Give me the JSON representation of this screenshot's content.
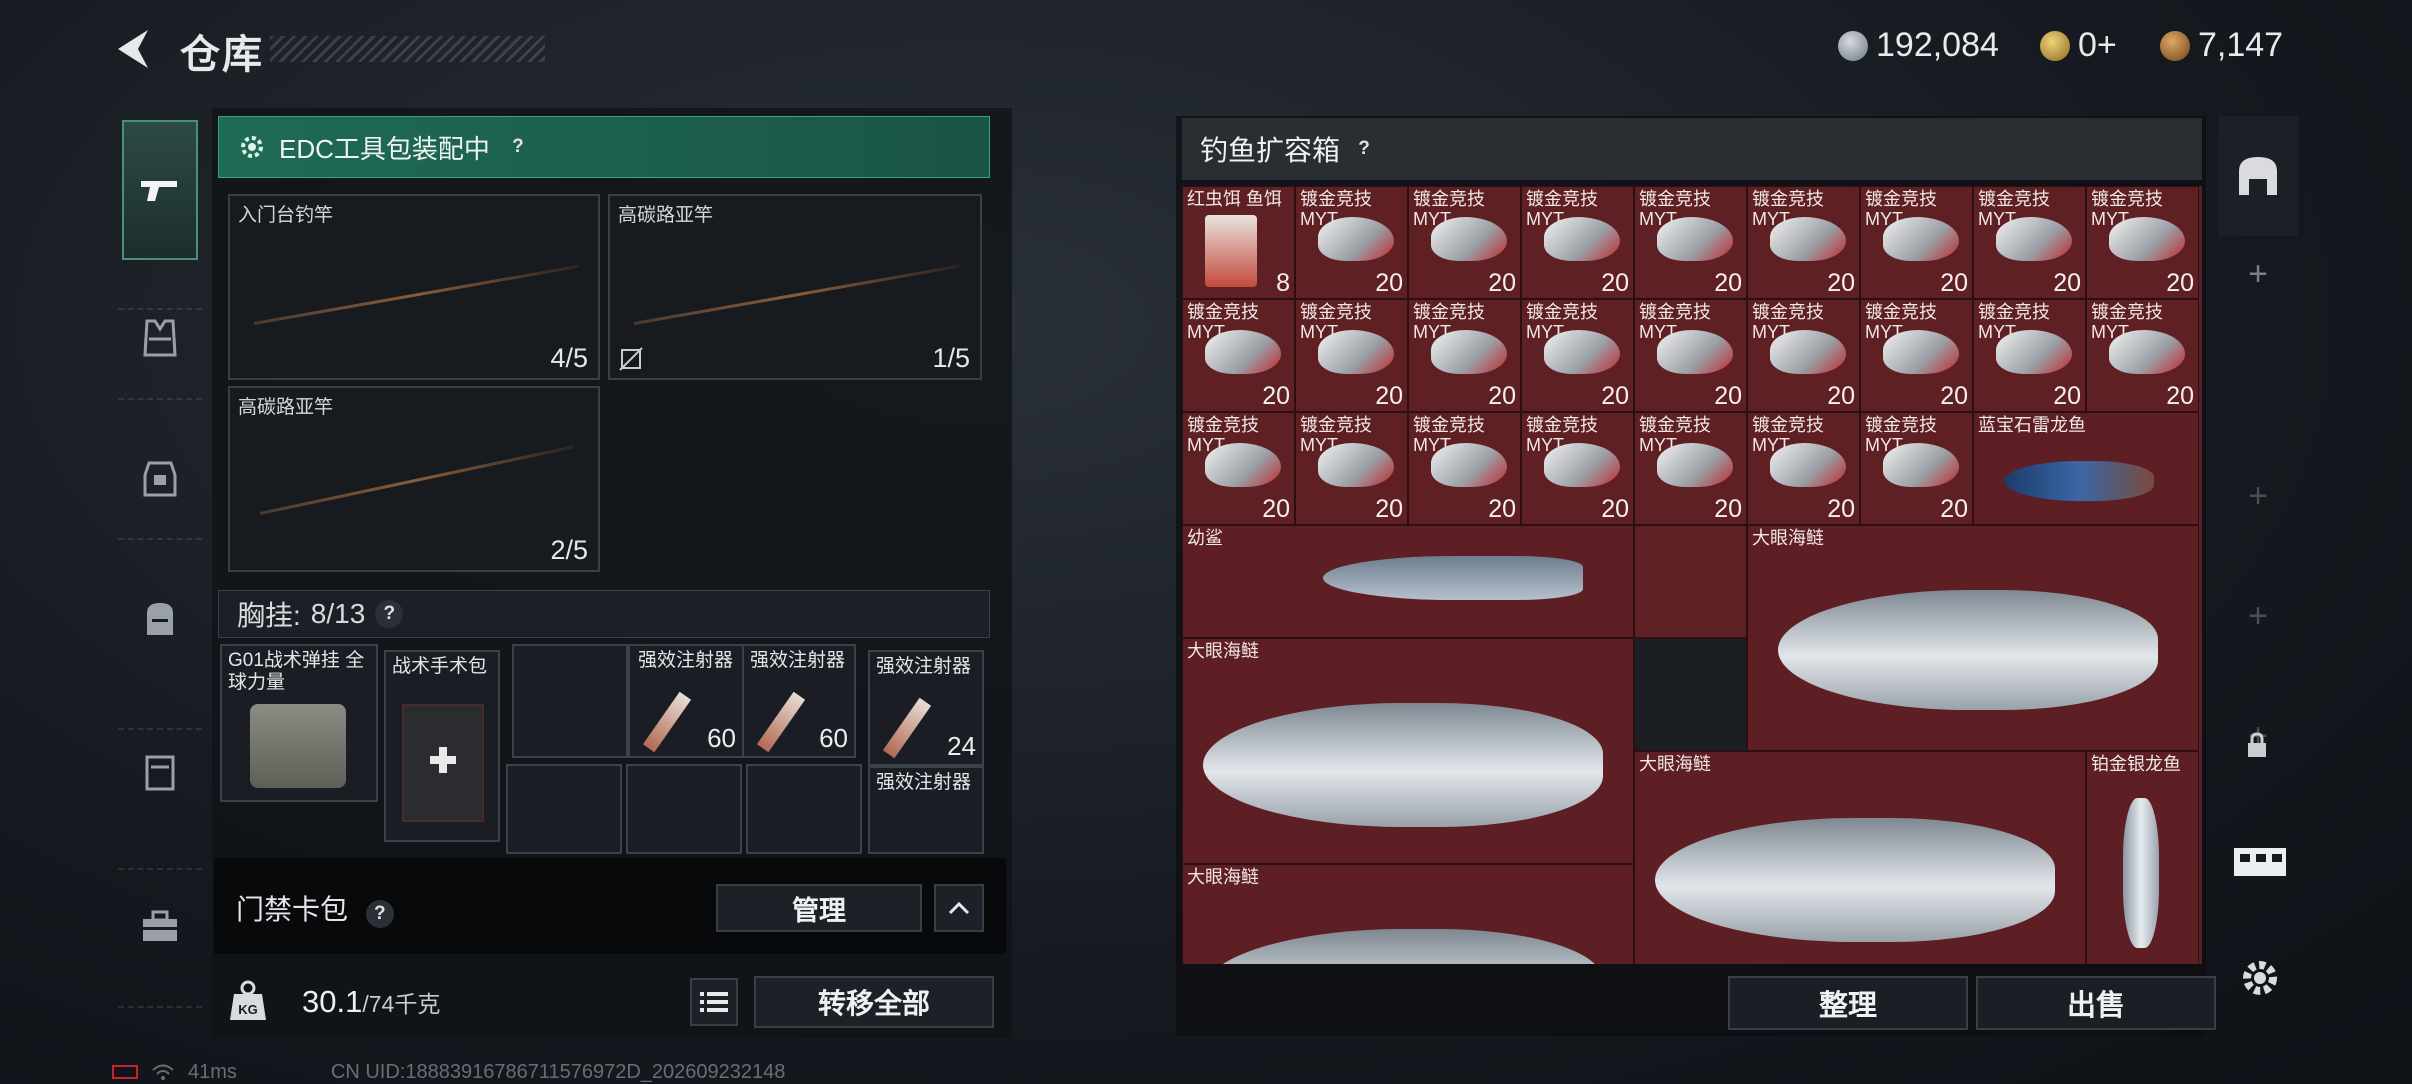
{
  "header": {
    "title": "仓库",
    "currencies": [
      {
        "icon": "silver-coin-icon",
        "value": "192,084",
        "color": "#9aa3ad"
      },
      {
        "icon": "gold-token-icon",
        "value": "0+",
        "color": "#c9a24a"
      },
      {
        "icon": "bronze-coin-icon",
        "value": "7,147",
        "color": "#b07a3a"
      }
    ]
  },
  "left_nav": {
    "items": [
      "gun-icon",
      "vest-icon",
      "armor-icon",
      "backpack-icon",
      "case-icon",
      "toolbox-icon"
    ]
  },
  "equipment": {
    "edc_banner": "EDC工具包装配中",
    "slots": [
      {
        "label": "入门台钓竿",
        "count": "4/5"
      },
      {
        "label": "高碳路亚竿",
        "count": "1/5"
      },
      {
        "label": "高碳路亚竿",
        "count": "2/5"
      }
    ]
  },
  "chest_rig": {
    "label": "胸挂:",
    "capacity": "8/13",
    "items": [
      {
        "label": "G01战术弹挂 全球力量"
      },
      {
        "label": "战术手术包"
      },
      {
        "label": "强效注射器",
        "count": "60"
      },
      {
        "label": "强效注射器",
        "count": "60"
      },
      {
        "label": "强效注射器",
        "count": "24"
      },
      {
        "label": "强效注射器"
      }
    ]
  },
  "card_pack": {
    "label": "门禁卡包",
    "manage": "管理"
  },
  "footer_left": {
    "weight": "30.1",
    "weight_max": "/74千克",
    "transfer_all": "转移全部"
  },
  "fishing_box": {
    "title": "钓鱼扩容箱",
    "bait_label": "红虫饵 鱼饵",
    "bait_count": "8",
    "lure_label": "镀金竞技\nMYT",
    "lure_count": "20",
    "fish": {
      "sapphire": "蓝宝石雷龙鱼",
      "shark": "幼鲨",
      "tarpon": "大眼海鲢",
      "platinum": "铂金银龙鱼"
    }
  },
  "footer_right": {
    "sort": "整理",
    "sell": "出售"
  },
  "status_bar": {
    "ping": "41ms",
    "uid": "CN UID:18883916786711576972D_202609232148"
  }
}
